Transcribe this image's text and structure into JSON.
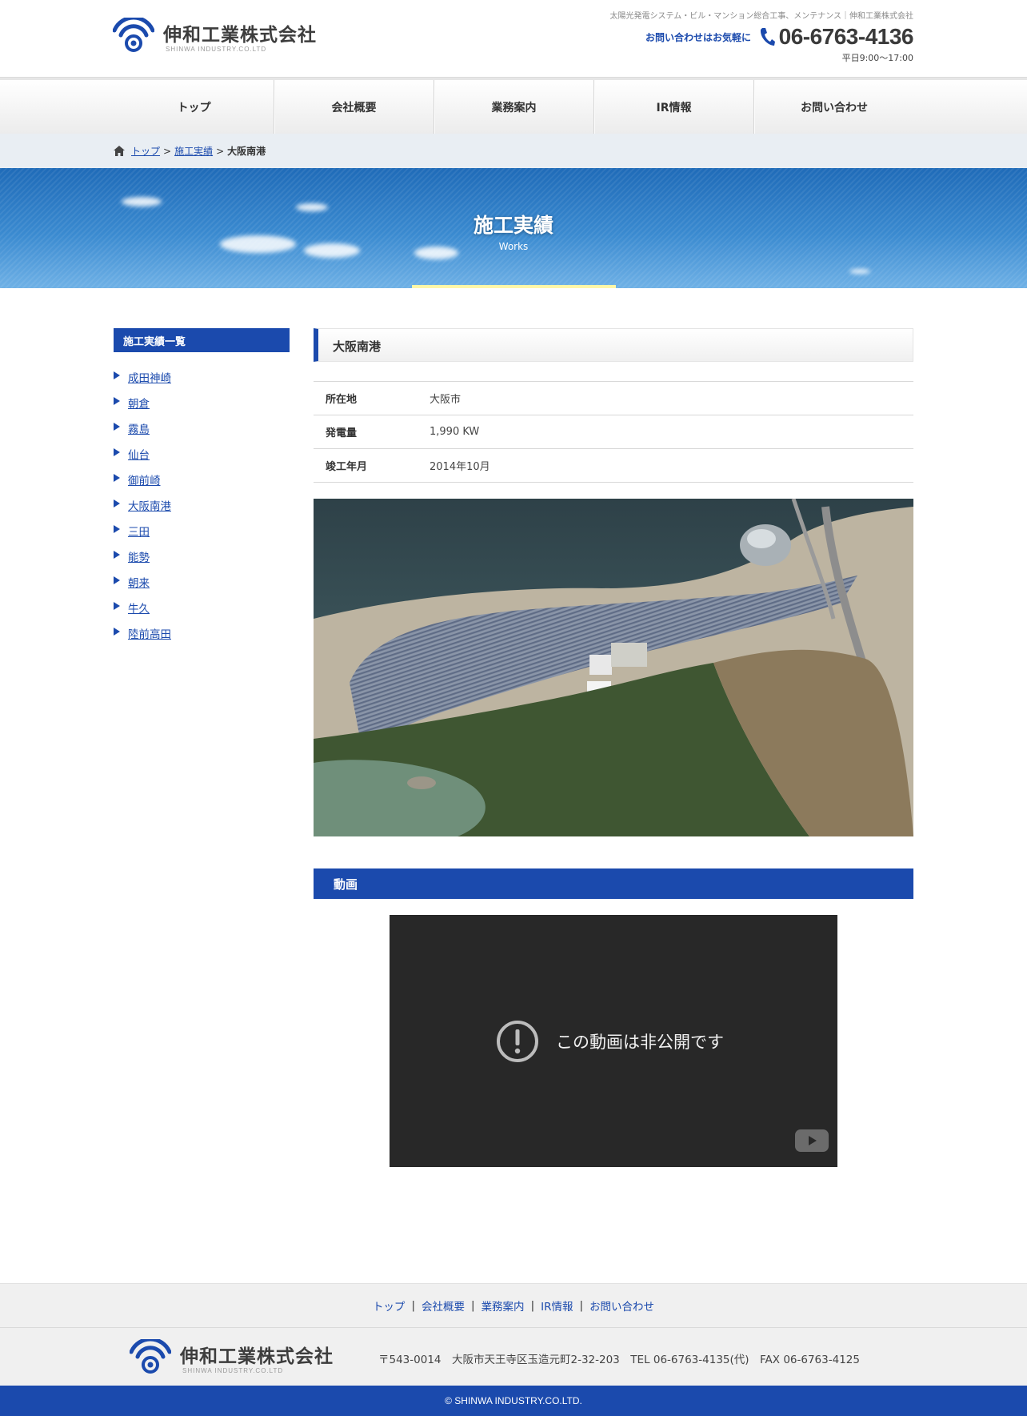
{
  "header": {
    "logo_name": "伸和工業株式会社",
    "logo_sub": "SHINWA INDUSTRY.CO.LTD",
    "tagline": "太陽光発電システム・ビル・マンション総合工事、メンテナンス｜伸和工業株式会社",
    "contact_label": "お問い合わせはお気軽に",
    "phone": "06-6763-4136",
    "hours": "平日9:00～17:00"
  },
  "nav": {
    "items": [
      {
        "label": "トップ"
      },
      {
        "label": "会社概要"
      },
      {
        "label": "業務案内"
      },
      {
        "label": "IR情報"
      },
      {
        "label": "お問い合わせ"
      }
    ]
  },
  "breadcrumb": {
    "items": [
      {
        "label": "トップ"
      },
      {
        "label": "施工実績"
      }
    ],
    "separator": ">",
    "current": "大阪南港"
  },
  "hero": {
    "title": "施工実績",
    "subtitle": "Works"
  },
  "sidebar": {
    "title": "施工実績一覧",
    "items": [
      {
        "label": "成田神崎"
      },
      {
        "label": "朝倉"
      },
      {
        "label": "霧島"
      },
      {
        "label": "仙台"
      },
      {
        "label": "御前崎"
      },
      {
        "label": "大阪南港"
      },
      {
        "label": "三田"
      },
      {
        "label": "能勢"
      },
      {
        "label": "朝来"
      },
      {
        "label": "牛久"
      },
      {
        "label": "陸前高田"
      }
    ]
  },
  "main": {
    "title": "大阪南港",
    "specs": [
      {
        "label": "所在地",
        "value": "大阪市"
      },
      {
        "label": "発電量",
        "value": "1,990 KW"
      },
      {
        "label": "竣工年月",
        "value": "2014年10月"
      }
    ],
    "video_title": "動画",
    "video_message": "この動画は非公開です"
  },
  "footer": {
    "nav": [
      {
        "label": "トップ"
      },
      {
        "label": "会社概要"
      },
      {
        "label": "業務案内"
      },
      {
        "label": "IR情報"
      },
      {
        "label": "お問い合わせ"
      }
    ],
    "nav_separator": "|",
    "logo_name": "伸和工業株式会社",
    "logo_sub": "SHINWA INDUSTRY.CO.LTD",
    "address": "〒543-0014　大阪市天王寺区玉造元町2-32-203　TEL 06-6763-4135(代)　FAX 06-6763-4125",
    "copyright": "© SHINWA INDUSTRY.CO.LTD."
  },
  "colors": {
    "brand_blue": "#1b4aad",
    "hero_sky": "#3a8ad0",
    "hero_underline": "#fff7a8",
    "video_bg": "#282828",
    "footer_bg": "#f0f0f0"
  },
  "icons": {
    "logo": "wifi-signal-logo-icon",
    "phone": "phone-icon",
    "breadcrumb_home": "home-icon",
    "list_marker": "triangle-right-icon",
    "video_error": "alert-circle-icon",
    "video_brand": "youtube-icon"
  }
}
